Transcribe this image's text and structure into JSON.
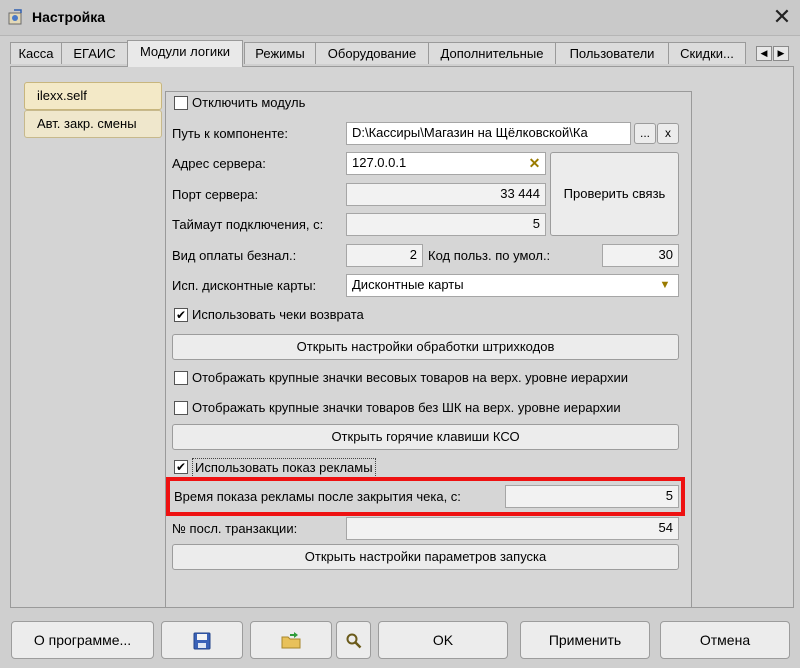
{
  "window": {
    "title": "Настройка",
    "close_glyph": "✕"
  },
  "tabs": [
    "Касса",
    "ЕГАИС",
    "Модули логики",
    "Режимы",
    "Оборудование",
    "Дополнительные",
    "Пользователи",
    "Скидки..."
  ],
  "tab_scroll": {
    "left": "◀",
    "right": "▶"
  },
  "sidebar": {
    "items": [
      "ilexx.self",
      "Авт. закр. смены"
    ]
  },
  "form": {
    "disable_module": {
      "label": "Отключить модуль",
      "checked": false
    },
    "component_path": {
      "label": "Путь к компоненте:",
      "value": "D:\\Кассиры\\Магазин на Щёлковской\\Ка",
      "browse": "...",
      "clear": "x"
    },
    "server_address": {
      "label": "Адрес сервера:",
      "value": "127.0.0.1",
      "clear_glyph": "✕"
    },
    "server_port": {
      "label": "Порт сервера:",
      "value": "33 444"
    },
    "check_connection": "Проверить связь",
    "timeout": {
      "label": "Таймаут подключения, с:",
      "value": "5"
    },
    "cashless_payment": {
      "label": "Вид оплаты безнал.:",
      "value": "2"
    },
    "default_user_code": {
      "label": "Код польз. по умол.:",
      "value": "30"
    },
    "discount_cards": {
      "label": "Исп. дисконтные карты:",
      "value": "Дисконтные карты",
      "arrow": "▼"
    },
    "use_return_receipts": {
      "label": "Использовать чеки возврата",
      "checked": true
    },
    "barcode_settings_button": "Открыть настройки обработки штрихкодов",
    "large_weight_icons": {
      "label": "Отображать крупные значки весовых товаров на верх. уровне иерархии",
      "checked": false
    },
    "large_nobarcode_icons": {
      "label": "Отображать крупные значки товаров без ШК на верх. уровне иерархии",
      "checked": false
    },
    "hotkeys_button": "Открыть горячие клавиши КСО",
    "use_ads": {
      "label": "Использовать показ рекламы",
      "checked": true
    },
    "ads_time": {
      "label": "Время показа рекламы после закрытия чека, с:",
      "value": "5"
    },
    "last_transaction": {
      "label": "№ посл. транзакции:",
      "value": "54"
    },
    "launch_params_button": "Открыть настройки параметров запуска"
  },
  "footer": {
    "about": "О программе...",
    "save_icon": "floppy-disk-icon",
    "export_icon": "folder-export-icon",
    "search_icon": "magnifier-icon",
    "ok": "OK",
    "apply": "Применить",
    "cancel": "Отмена"
  },
  "colors": {
    "highlight": "#ee1111",
    "sidebar_selected": "#f3e9c7",
    "dropdown_arrow": "#9a7b00"
  }
}
